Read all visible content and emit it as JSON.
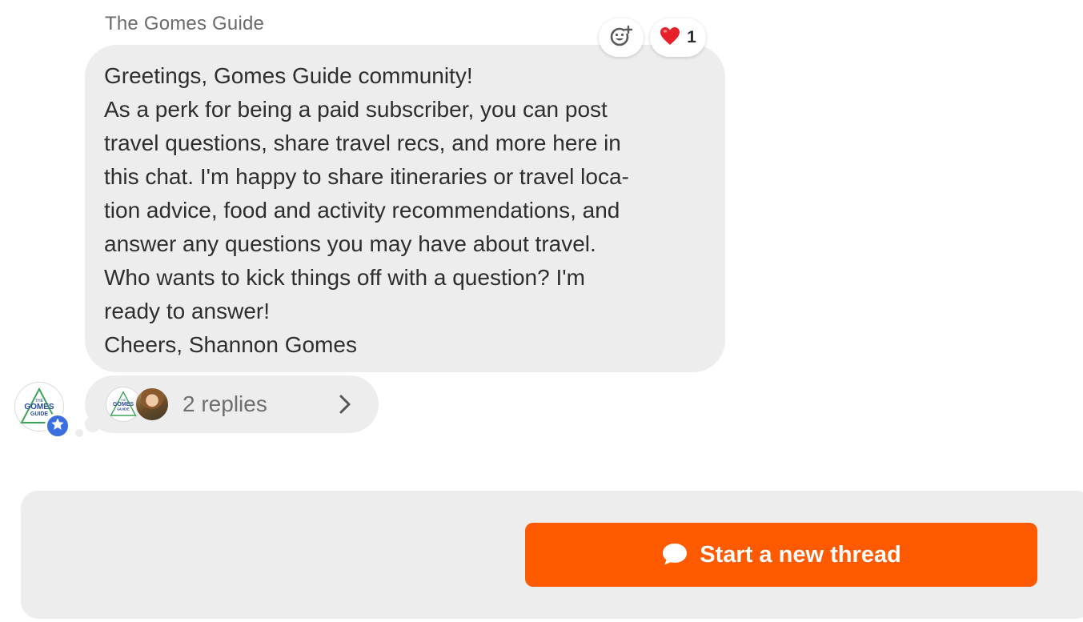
{
  "message": {
    "author": "The Gomes Guide",
    "lines": [
      "Greetings, Gomes Guide community!",
      "As a perk for being a paid subscriber, you can post",
      "travel questions, share travel recs, and more here in",
      "this chat. I'm happy to share itineraries or travel loca-",
      "tion advice, food and activity recommendations, and",
      "answer any questions you may have about travel.",
      "Who wants to kick things off with a question? I'm",
      "ready to answer!",
      "Cheers, Shannon Gomes"
    ],
    "reactions": {
      "add_icon": "add-reaction-icon",
      "heart_emoji": "❤️",
      "heart_count": "1"
    }
  },
  "avatar": {
    "logo_line1": "THE",
    "logo_line2": "GOMES",
    "logo_line3": "GUIDE",
    "badge_icon": "star-icon"
  },
  "replies": {
    "label": "2 replies",
    "icon": "chevron-right-icon"
  },
  "footer": {
    "new_thread_label": "Start a new thread",
    "new_thread_icon": "chat-bubble-icon"
  },
  "colors": {
    "accent": "#ff5a00",
    "bubble": "#ededed",
    "badge": "#3b6fe0"
  }
}
